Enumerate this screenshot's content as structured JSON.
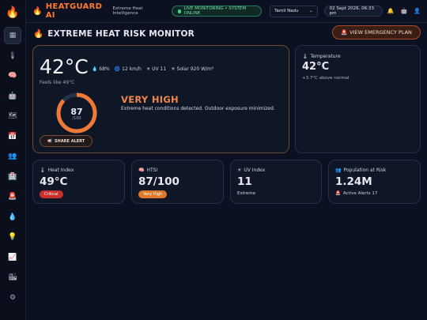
{
  "app": {
    "brand": "HEATGUARD AI",
    "tagline": "Extreme Heat Intelligence",
    "live_status": "LIVE MONITORING • SYSTEM ONLINE",
    "region": "Tamil Nadu",
    "datetime": "02 Sept 2026, 06:33 pm"
  },
  "sidebar": {
    "icons": [
      "dashboard-icon",
      "thermometer-icon",
      "brain-icon",
      "robot-icon",
      "map-icon",
      "calendar-icon",
      "people-icon",
      "hospital-icon",
      "siren-icon",
      "droplet-icon",
      "bulb-icon",
      "chart-icon",
      "city-icon",
      "gear-icon",
      "theme-toggle-icon"
    ],
    "glyphs": [
      "▦",
      "🌡",
      "🧠",
      "🤖",
      "🗺",
      "📅",
      "👥",
      "🏥",
      "🚨",
      "💧",
      "💡",
      "📈",
      "🏙",
      "⚙",
      "◐"
    ]
  },
  "header": {
    "title": "EXTREME HEAT RISK MONITOR",
    "emergency_label": "VIEW EMERGENCY PLAN"
  },
  "hero": {
    "temperature": "42°C",
    "humidity": "68%",
    "wind": "12 km/h",
    "uv": "UV 11",
    "solar": "Solar 920 W/m²",
    "feels_like": "Feels like 49°C",
    "gauge_value": "87",
    "gauge_unit": "/100",
    "gauge_fraction": 0.87,
    "risk_level": "VERY HIGH",
    "risk_desc": "Extreme heat conditions detected. Outdoor exposure minimized.",
    "share_label": "SHARE ALERT"
  },
  "temp_card": {
    "label": "Temperature",
    "value": "42°C",
    "sub": "+3.7°C above normal"
  },
  "stats": {
    "heat_index": {
      "label": "Heat Index",
      "value": "49°C",
      "badge": "Critical"
    },
    "htsi": {
      "label": "HTSI",
      "value": "87/100",
      "badge": "Very High"
    },
    "uv": {
      "label": "UV Index",
      "value": "11",
      "sub": "Extreme"
    },
    "population": {
      "label": "Population at Risk",
      "value": "1.24M",
      "sub": "Active Alerts 17"
    }
  },
  "colors": {
    "accent": "#ff7a2b",
    "critical": "#c9302c",
    "very_high": "#e0782a",
    "live": "#3ddc84"
  }
}
